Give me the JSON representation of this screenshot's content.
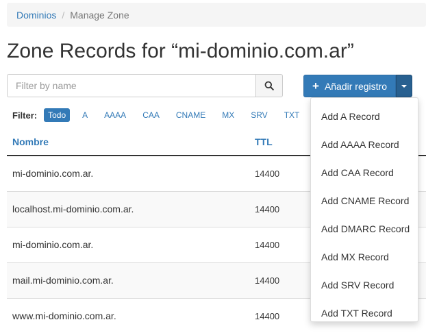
{
  "breadcrumb": {
    "root": "Dominios",
    "separator": "/",
    "current": "Manage Zone"
  },
  "page_title": "Zone Records for “mi-dominio.com.ar”",
  "search": {
    "placeholder": "Filter by name",
    "value": ""
  },
  "add_button": {
    "label": "Añadir registro"
  },
  "filter": {
    "label": "Filter:",
    "items": [
      "Todo",
      "A",
      "AAAA",
      "CAA",
      "CNAME",
      "MX",
      "SRV",
      "TXT"
    ],
    "active": "Todo"
  },
  "table": {
    "headers": {
      "name": "Nombre",
      "ttl": "TTL"
    },
    "rows": [
      {
        "name": "mi-dominio.com.ar.",
        "ttl": "14400"
      },
      {
        "name": "localhost.mi-dominio.com.ar.",
        "ttl": "14400"
      },
      {
        "name": "mi-dominio.com.ar.",
        "ttl": "14400"
      },
      {
        "name": "mail.mi-dominio.com.ar.",
        "ttl": "14400"
      },
      {
        "name": "www.mi-dominio.com.ar.",
        "ttl": "14400"
      }
    ]
  },
  "dropdown": {
    "items": [
      "Add A Record",
      "Add AAAA Record",
      "Add CAA Record",
      "Add CNAME Record",
      "Add DMARC Record",
      "Add MX Record",
      "Add SRV Record",
      "Add TXT Record"
    ]
  },
  "colors": {
    "primary": "#337ab7",
    "primary_dark": "#286090"
  }
}
